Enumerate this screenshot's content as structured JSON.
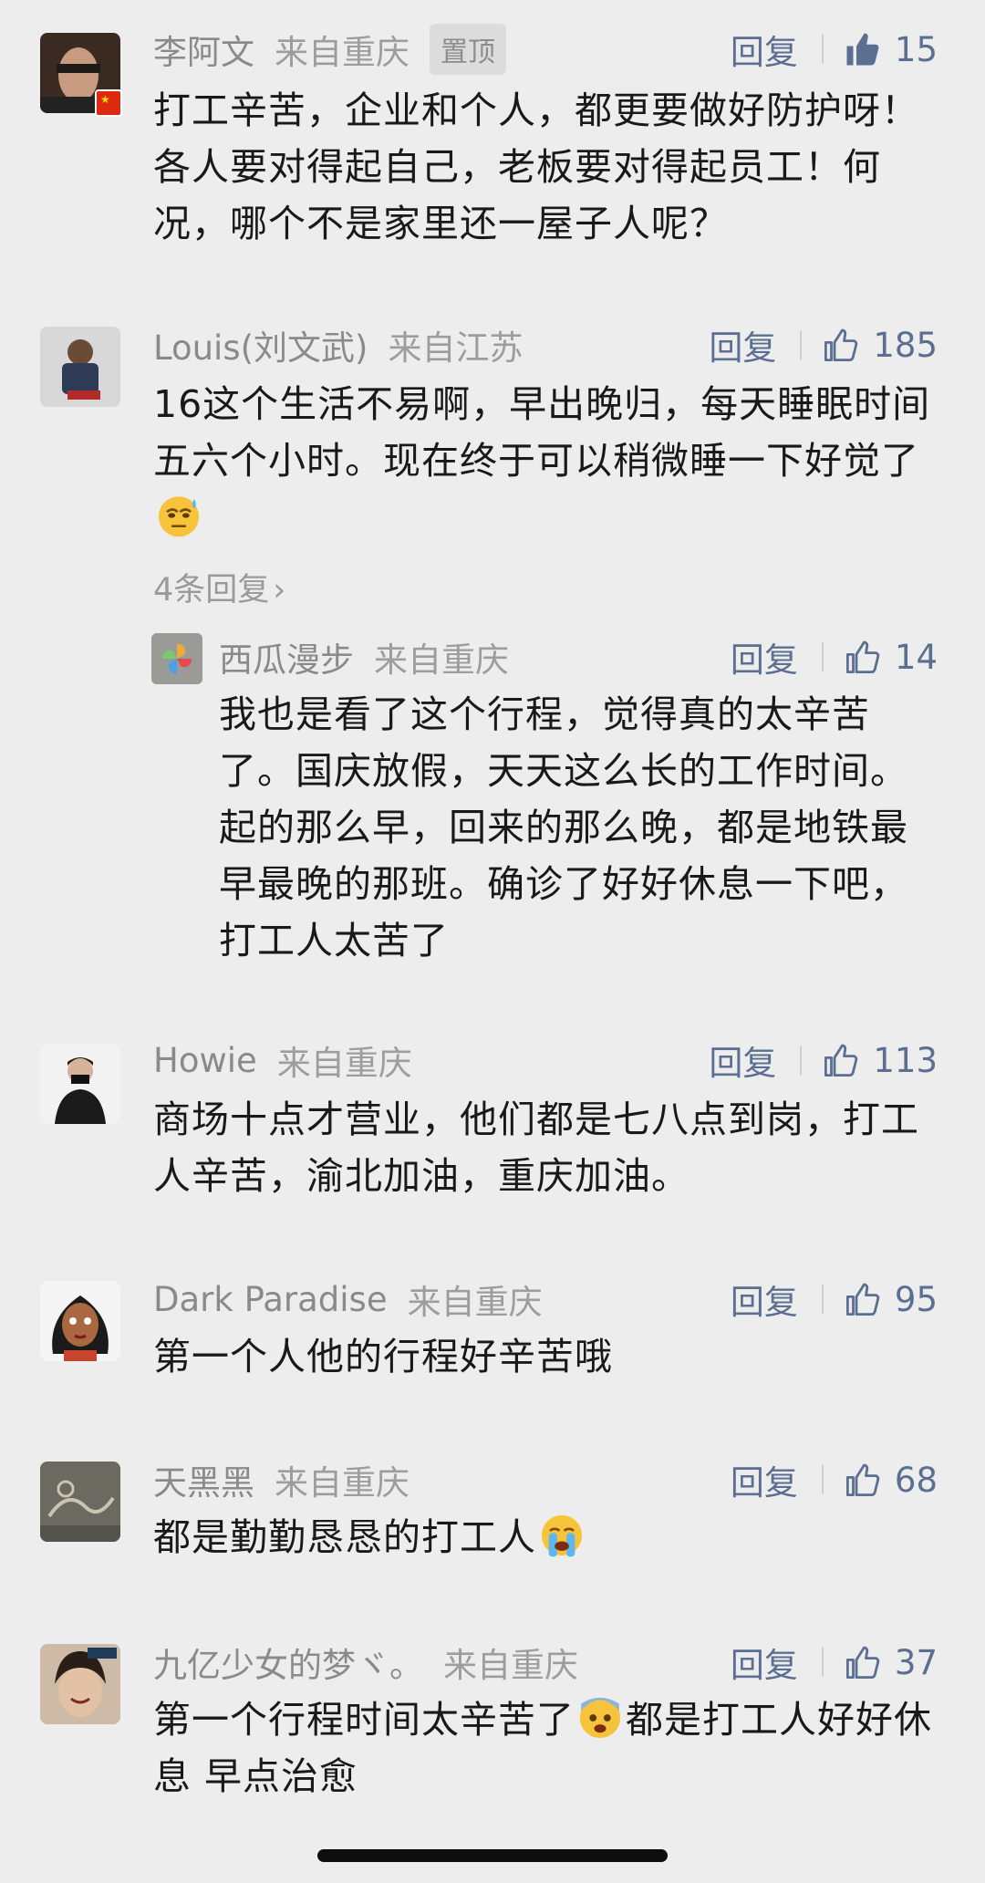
{
  "comments": [
    {
      "name": "李阿文",
      "location": "来自重庆",
      "pinned": "置顶",
      "reply_label": "回复",
      "likes": "15",
      "text": "打工辛苦，企业和个人，都更要做好防护呀！各人要对得起自己，老板要对得起员工！何况，哪个不是家里还一屋子人呢？"
    },
    {
      "name": "Louis(刘文武)",
      "location": "来自江苏",
      "reply_label": "回复",
      "likes": "185",
      "text": "16这个生活不易啊，早出晚归，每天睡眠时间五六个小时。现在终于可以稍微睡一下好觉了",
      "more_replies": "4条回复",
      "reply": {
        "name": "西瓜漫步",
        "location": "来自重庆",
        "reply_label": "回复",
        "likes": "14",
        "text": "我也是看了这个行程，觉得真的太辛苦了。国庆放假，天天这么长的工作时间。起的那么早，回来的那么晚，都是地铁最早最晚的那班。确诊了好好休息一下吧，打工人太苦了"
      }
    },
    {
      "name": "Howie",
      "location": "来自重庆",
      "reply_label": "回复",
      "likes": "113",
      "text": "商场十点才营业，他们都是七八点到岗，打工人辛苦，渝北加油，重庆加油。"
    },
    {
      "name": "Dark Paradise",
      "location": "来自重庆",
      "reply_label": "回复",
      "likes": "95",
      "text": "第一个人他的行程好辛苦哦"
    },
    {
      "name": "天黑黑",
      "location": "来自重庆",
      "reply_label": "回复",
      "likes": "68",
      "text": "都是勤勤恳恳的打工人"
    },
    {
      "name": "九亿少女的梦ヾ。",
      "location": "来自重庆",
      "reply_label": "回复",
      "likes": "37",
      "text_a": "第一个行程时间太辛苦了",
      "text_b": "都是打工人好好休息 早点治愈"
    }
  ],
  "icons": {
    "thumb_filled": "thumbs-up-filled-icon",
    "thumb_outline": "thumbs-up-outline-icon",
    "chevron": "chevron-right-icon",
    "flag": "china-flag-icon"
  },
  "colors": {
    "background": "#ededed",
    "link": "#5a6f91",
    "meta": "#8a8a8a",
    "text": "#191919"
  }
}
